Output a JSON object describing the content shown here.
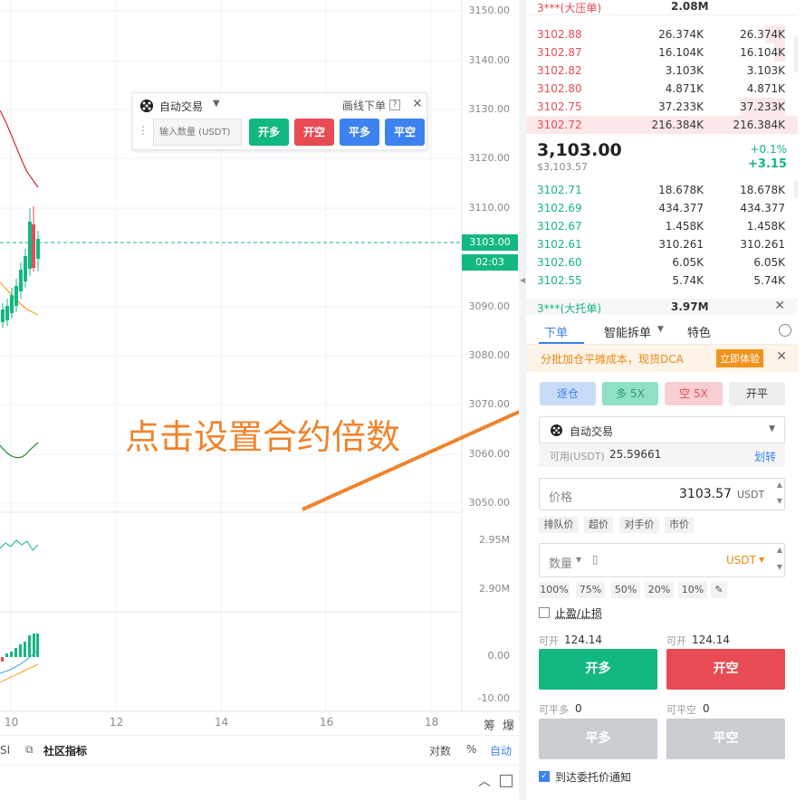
{
  "chart": {
    "y_labels": [
      "3150.00",
      "3140.00",
      "3130.00",
      "3120.00",
      "3110.00",
      "3090.00",
      "3080.00",
      "3070.00",
      "3060.00",
      "3050.00",
      "2.95M",
      "2.90M",
      "0.00",
      "-10.00"
    ],
    "price_tag": "3103.00",
    "time_tag": "02:03",
    "x_labels": [
      "10",
      "12",
      "14",
      "16",
      "18"
    ],
    "corner_labels": [
      "筹",
      "爆"
    ]
  },
  "quick_order": {
    "mode": "自动交易",
    "draw_order": "画线下单",
    "help": "?",
    "qty_placeholder": "输入数量 (USDT)",
    "open_long": "开多",
    "open_short": "开空",
    "close_long": "平多",
    "close_short": "平空",
    "colors": {
      "long": "#13b87f",
      "short": "#e84b53",
      "close": "#3c82f0"
    }
  },
  "bottom_bar": {
    "left_frag": "SI",
    "community": "社区指标",
    "log": "对数",
    "percent": "%",
    "auto": "自动"
  },
  "annotation": {
    "text": "点击设置合约倍数",
    "color": "#f0832c"
  },
  "orderbook": {
    "top_header": {
      "label": "3***(大压单)",
      "value": "2.08M"
    },
    "asks": [
      {
        "price": "3102.88",
        "amount": "26.374K",
        "total": "26.374K",
        "depth": 0.3
      },
      {
        "price": "3102.87",
        "amount": "16.104K",
        "total": "16.104K",
        "depth": 0.2
      },
      {
        "price": "3102.82",
        "amount": "3.103K",
        "total": "3.103K",
        "depth": 0.05
      },
      {
        "price": "3102.80",
        "amount": "4.871K",
        "total": "4.871K",
        "depth": 0.07
      },
      {
        "price": "3102.75",
        "amount": "37.233K",
        "total": "37.233K",
        "depth": 0.4
      },
      {
        "price": "3102.72",
        "amount": "216.384K",
        "total": "216.384K",
        "depth": 1.0
      }
    ],
    "last_price": "3,103.00",
    "last_price_usd": "$3,103.57",
    "change_pct": "+0.1%",
    "change_abs": "+3.15",
    "bids": [
      {
        "price": "3102.71",
        "amount": "18.678K",
        "total": "18.678K"
      },
      {
        "price": "3102.69",
        "amount": "434.377",
        "total": "434.377"
      },
      {
        "price": "3102.67",
        "amount": "1.458K",
        "total": "1.458K"
      },
      {
        "price": "3102.61",
        "amount": "310.261",
        "total": "310.261"
      },
      {
        "price": "3102.60",
        "amount": "6.05K",
        "total": "6.05K"
      },
      {
        "price": "3102.55",
        "amount": "5.74K",
        "total": "5.74K"
      }
    ],
    "bottom_header": {
      "label": "3***(大托单)",
      "value": "3.97M"
    }
  },
  "trade": {
    "tabs": [
      "下单",
      "智能拆单",
      "特色"
    ],
    "promo": "分批加仓平摊成本，现货DCA",
    "promo_btn": "立即体验",
    "margin_mode": "逐仓",
    "long_leverage": "多 5X",
    "short_leverage": "空 5X",
    "open_close": "开平",
    "mode_select": "自动交易",
    "available_label": "可用(USDT)",
    "available_value": "25.59661",
    "transfer": "划转",
    "price_label": "价格",
    "price_value": "3103.57",
    "price_unit": "USDT",
    "price_shortcuts": [
      "排队价",
      "超价",
      "对手价",
      "市价"
    ],
    "qty_label": "数量",
    "qty_unit": "USDT",
    "percents": [
      "100%",
      "75%",
      "50%",
      "20%",
      "10%"
    ],
    "tpsl": "止盈/止损",
    "can_open_label": "可开",
    "can_open_long": "124.14",
    "can_open_short": "124.14",
    "open_long": "开多",
    "open_short": "开空",
    "can_close_long_label": "可平多",
    "can_close_long": "0",
    "can_close_short_label": "可平空",
    "can_close_short": "0",
    "close_long": "平多",
    "close_short": "平空",
    "notify": "到达委托价通知"
  }
}
